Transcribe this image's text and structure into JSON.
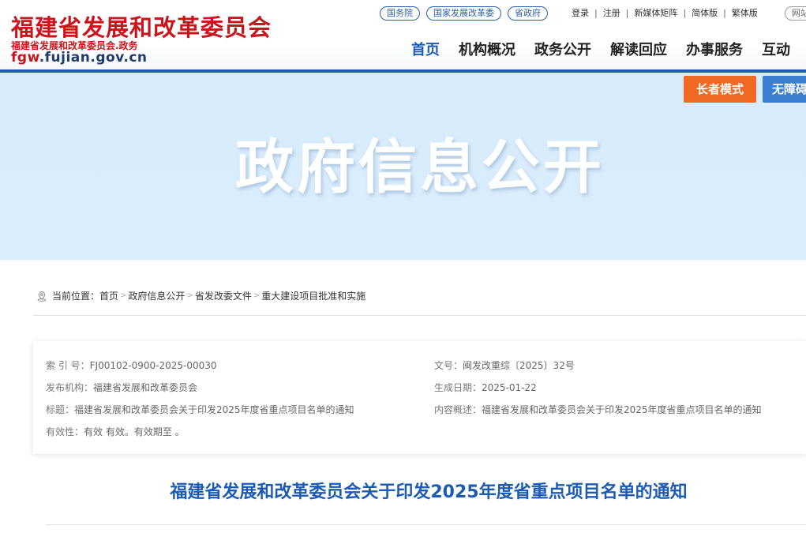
{
  "header": {
    "site_title": "福建省发展和改革委员会",
    "site_subtitle": "福建省发展和改革委员会.政务",
    "domain_prefix": "fgw",
    "domain_rest": ".fujian.gov.cn",
    "top_links": [
      "国务院",
      "国家发展改革委",
      "省政府"
    ],
    "util_links": [
      "登录",
      "注册",
      "新媒体矩阵",
      "简体版",
      "繁体版"
    ],
    "util_pill": "网站",
    "nav": [
      "首页",
      "机构概况",
      "政务公开",
      "解读回应",
      "办事服务",
      "互动"
    ]
  },
  "banner": {
    "title": "政府信息公开",
    "elder_mode": "长者模式",
    "accessible_mode": "无障碍"
  },
  "breadcrumb": {
    "label": "当前位置：",
    "items": [
      "首页",
      "政府信息公开",
      "省发改委文件",
      "重大建设项目批准和实施"
    ]
  },
  "meta": {
    "index_label": "索 引 号：",
    "index_value": "FJ00102-0900-2025-00030",
    "doc_no_label": "文号：",
    "doc_no_value": "闽发改重综〔2025〕32号",
    "org_label": "发布机构：",
    "org_value": "福建省发展和改革委员会",
    "date_label": "生成日期：",
    "date_value": "2025-01-22",
    "title_label": "标题：",
    "title_value": "福建省发展和改革委员会关于印发2025年度省重点项目名单的通知",
    "summary_label": "内容概述：",
    "summary_value": "福建省发展和改革委员会关于印发2025年度省重点项目名单的通知",
    "validity_label": "有效性：",
    "validity_value": "有效 有效。有效期至 。"
  },
  "document": {
    "title": "福建省发展和改革委员会关于印发2025年度省重点项目名单的通知"
  },
  "colors": {
    "brand_red": "#c8161d",
    "brand_blue": "#1c5bb5",
    "elder_orange": "#f06a23",
    "banner_bg": "#d8ebfb"
  }
}
